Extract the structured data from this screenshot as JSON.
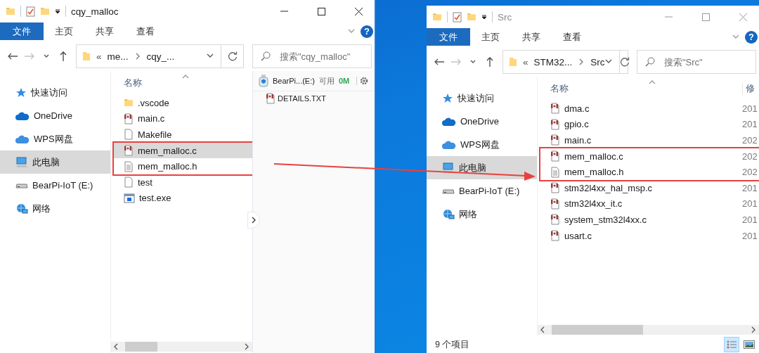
{
  "windows": [
    {
      "title": "cqy_malloc",
      "active": true,
      "ribbon_tabs": [
        {
          "label": "文件",
          "kind": "menu"
        },
        {
          "label": "主页",
          "kind": "tab"
        },
        {
          "label": "共享",
          "kind": "tab"
        },
        {
          "label": "查看",
          "kind": "tab"
        }
      ],
      "help": "?",
      "address": {
        "prefix": "«",
        "crumbs": [
          "me...",
          "cqy_..."
        ]
      },
      "search": {
        "placeholder": "搜索\"cqy_malloc\""
      },
      "nav": [
        {
          "label": "快速访问",
          "kind": "star",
          "selected": false
        },
        {
          "label": "OneDrive",
          "kind": "cloud",
          "selected": false
        },
        {
          "label": "WPS网盘",
          "kind": "cloud2",
          "selected": false
        },
        {
          "label": "此电脑",
          "kind": "pc",
          "selected": true
        },
        {
          "label": "BearPi-IoT (E:)",
          "kind": "drive",
          "selected": false
        },
        {
          "label": "网络",
          "kind": "network",
          "selected": false
        }
      ],
      "columns": [
        {
          "label": "名称"
        }
      ],
      "files": [
        {
          "name": ".vscode",
          "kind": "folder",
          "selected": false,
          "highlighted": false
        },
        {
          "name": "main.c",
          "kind": "c",
          "selected": false,
          "highlighted": false
        },
        {
          "name": "Makefile",
          "kind": "blank",
          "selected": false,
          "highlighted": false
        },
        {
          "name": "mem_malloc.c",
          "kind": "c",
          "selected": true,
          "highlighted": true
        },
        {
          "name": "mem_malloc.h",
          "kind": "text",
          "selected": false,
          "highlighted": true
        },
        {
          "name": "test",
          "kind": "blank",
          "selected": false,
          "highlighted": false
        },
        {
          "name": "test.exe",
          "kind": "exe",
          "selected": false,
          "highlighted": false
        }
      ],
      "preview": {
        "drive": "BearPi...(E:)",
        "free_label": "可用",
        "free_value": "0M",
        "files": [
          {
            "name": "DETAILS.TXT",
            "kind": "c"
          }
        ]
      }
    },
    {
      "title": "Src",
      "active": false,
      "ribbon_tabs": [
        {
          "label": "文件",
          "kind": "menu"
        },
        {
          "label": "主页",
          "kind": "tab"
        },
        {
          "label": "共享",
          "kind": "tab"
        },
        {
          "label": "查看",
          "kind": "tab"
        }
      ],
      "help": "?",
      "address": {
        "prefix": "«",
        "crumbs": [
          "STM32...",
          "Src"
        ]
      },
      "search": {
        "placeholder": "搜索\"Src\""
      },
      "nav": [
        {
          "label": "快速访问",
          "kind": "star",
          "selected": false
        },
        {
          "label": "OneDrive",
          "kind": "cloud",
          "selected": false
        },
        {
          "label": "WPS网盘",
          "kind": "cloud2",
          "selected": false
        },
        {
          "label": "此电脑",
          "kind": "pc",
          "selected": true
        },
        {
          "label": "BearPi-IoT (E:)",
          "kind": "drive",
          "selected": false
        },
        {
          "label": "网络",
          "kind": "network",
          "selected": false
        }
      ],
      "columns": [
        {
          "label": "名称"
        },
        {
          "label": "修"
        }
      ],
      "files": [
        {
          "name": "dma.c",
          "kind": "c",
          "modified": "201",
          "selected": false,
          "highlighted": false
        },
        {
          "name": "gpio.c",
          "kind": "c",
          "modified": "201",
          "selected": false,
          "highlighted": false
        },
        {
          "name": "main.c",
          "kind": "c",
          "modified": "202",
          "selected": false,
          "highlighted": false
        },
        {
          "name": "mem_malloc.c",
          "kind": "c",
          "modified": "202",
          "selected": false,
          "highlighted": true
        },
        {
          "name": "mem_malloc.h",
          "kind": "text",
          "modified": "202",
          "selected": false,
          "highlighted": true
        },
        {
          "name": "stm32l4xx_hal_msp.c",
          "kind": "c",
          "modified": "201",
          "selected": false,
          "highlighted": false
        },
        {
          "name": "stm32l4xx_it.c",
          "kind": "c",
          "modified": "201",
          "selected": false,
          "highlighted": false
        },
        {
          "name": "system_stm32l4xx.c",
          "kind": "c",
          "modified": "201",
          "selected": false,
          "highlighted": false
        },
        {
          "name": "usart.c",
          "kind": "c",
          "modified": "201",
          "selected": false,
          "highlighted": false
        }
      ],
      "status_bar": {
        "text": "9 个项目",
        "views": [
          {
            "kind": "details",
            "selected": true
          },
          {
            "kind": "thumbnails",
            "selected": false
          }
        ]
      }
    }
  ]
}
